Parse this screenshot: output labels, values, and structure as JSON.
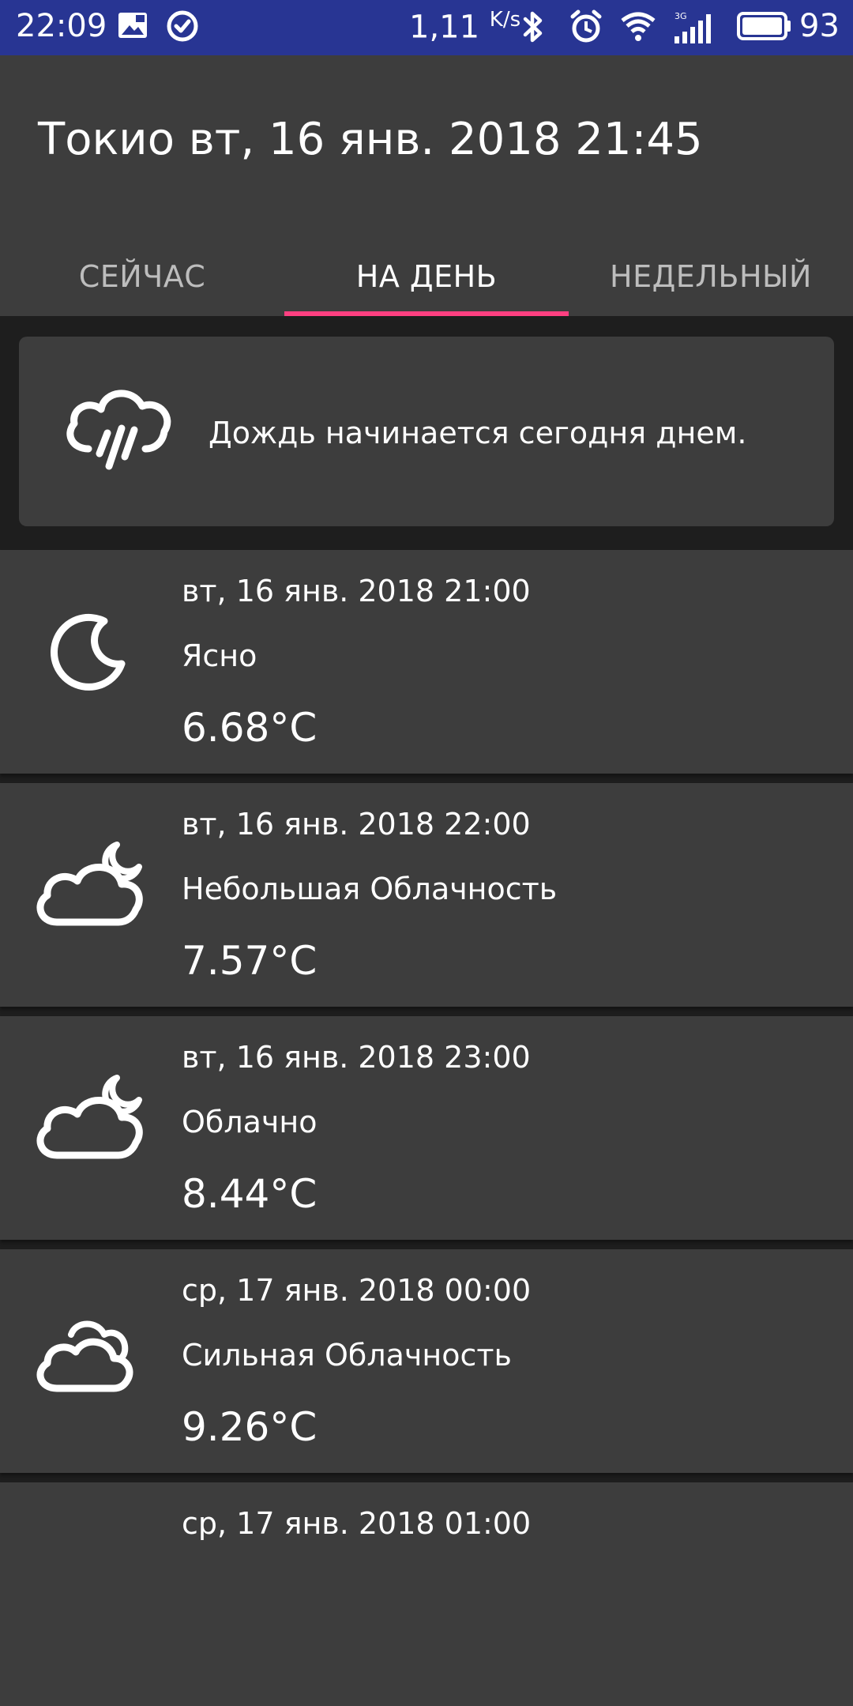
{
  "status_bar": {
    "time": "22:09",
    "speed": "1,11",
    "speed_unit": "K/s",
    "network": "3G",
    "battery": "93",
    "icons": [
      "image-icon",
      "check-circle-icon",
      "bluetooth-icon",
      "alarm-icon",
      "wifi-icon",
      "signal-icon",
      "battery-icon"
    ]
  },
  "header": {
    "title": "Токио вт, 16 янв. 2018 21:45"
  },
  "tabs": [
    {
      "label": "СЕЙЧАС",
      "active": false
    },
    {
      "label": "НА ДЕНЬ",
      "active": true
    },
    {
      "label": "НЕДЕЛЬНЫЙ",
      "active": false
    }
  ],
  "alert": {
    "icon": "rain-cloud-icon",
    "text": "Дождь начинается сегодня днем."
  },
  "forecast": [
    {
      "date": "вт, 16 янв. 2018 21:00",
      "description": "Ясно",
      "temp": "6.68°C",
      "icon": "moon-icon"
    },
    {
      "date": "вт, 16 янв. 2018 22:00",
      "description": "Небольшая Облачность",
      "temp": "7.57°C",
      "icon": "cloud-moon-icon"
    },
    {
      "date": "вт, 16 янв. 2018 23:00",
      "description": "Облачно",
      "temp": "8.44°C",
      "icon": "cloud-moon-icon"
    },
    {
      "date": "ср, 17 янв. 2018 00:00",
      "description": "Сильная Облачность",
      "temp": "9.26°C",
      "icon": "clouds-icon"
    },
    {
      "date": "ср, 17 янв. 2018 01:00"
    }
  ],
  "colors": {
    "status_bar": "#283593",
    "surface": "#3d3d3d",
    "background": "#1e1e1e",
    "tab_indicator": "#ff4081"
  }
}
